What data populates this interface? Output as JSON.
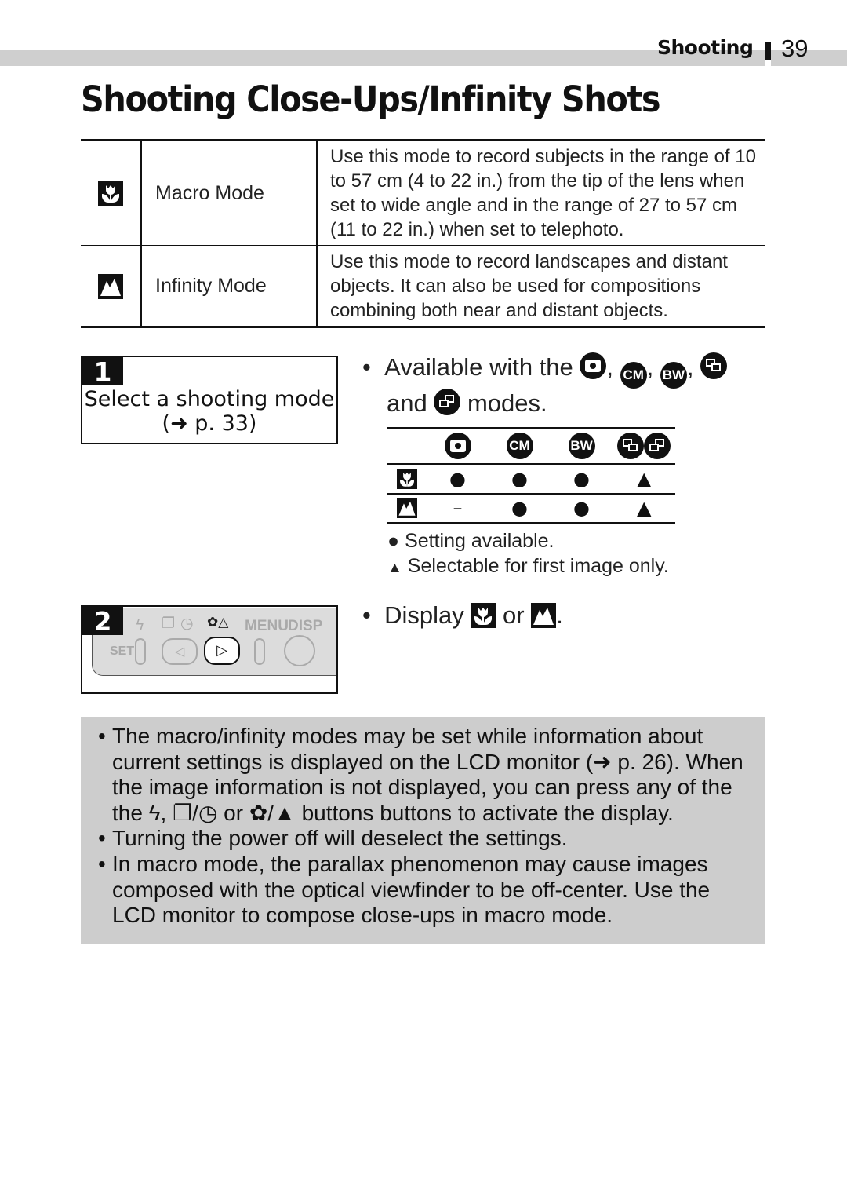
{
  "header": {
    "section": "Shooting",
    "page_number": "39"
  },
  "title": "Shooting Close-Ups/Infinity Shots",
  "mode_table": [
    {
      "icon": "macro-icon",
      "name": "Macro Mode",
      "description": "Use this mode to record subjects in the range of 10 to 57 cm (4 to 22 in.) from the tip of the lens when set to wide angle and in the range of 27 to 57 cm (11 to 22 in.) when set to telephoto."
    },
    {
      "icon": "infinity-icon",
      "name": "Infinity Mode",
      "description": "Use this mode to record landscapes and distant objects. It can also be used for compositions combining both near and distant objects."
    }
  ],
  "steps": [
    {
      "number": "1",
      "text_line1": "Select a shooting mode",
      "text_line2": "(➜ p. 33)"
    },
    {
      "number": "2"
    }
  ],
  "camera_panel": {
    "labels": [
      "SET",
      "MENU",
      "DISP"
    ]
  },
  "availability": {
    "intro_prefix": "Available with the",
    "intro_and": "and",
    "intro_suffix": "modes.",
    "mode_icons": [
      "auto-mode-icon",
      "color-accent-icon",
      "black-white-icon",
      "stitch-assist-icon",
      "stitch-assist-alt-icon"
    ],
    "columns": [
      "auto",
      "CM",
      "BW",
      "stitch"
    ],
    "rows": [
      {
        "mode": "macro",
        "values": [
          "●",
          "●",
          "●",
          "▲"
        ]
      },
      {
        "mode": "infinity",
        "values": [
          "–",
          "●",
          "●",
          "▲"
        ]
      }
    ],
    "legend": [
      {
        "symbol": "●",
        "text": "Setting available."
      },
      {
        "symbol": "▲",
        "text": "Selectable for first image only."
      }
    ]
  },
  "display_bullet": {
    "prefix": "Display",
    "or": "or",
    "suffix": "."
  },
  "notes": [
    "The macro/infinity modes may be set while information about current settings is displayed on the LCD monitor (➜ p. 26). When the image information is not displayed, you can press any of the the ϟ, ❐/◷ or ✿/▲ buttons buttons to activate the display.",
    "Turning the power off will deselect the settings.",
    "In macro mode, the parallax phenomenon may cause images composed with the optical viewfinder to be off-center. Use the LCD monitor to compose close-ups in macro mode."
  ]
}
